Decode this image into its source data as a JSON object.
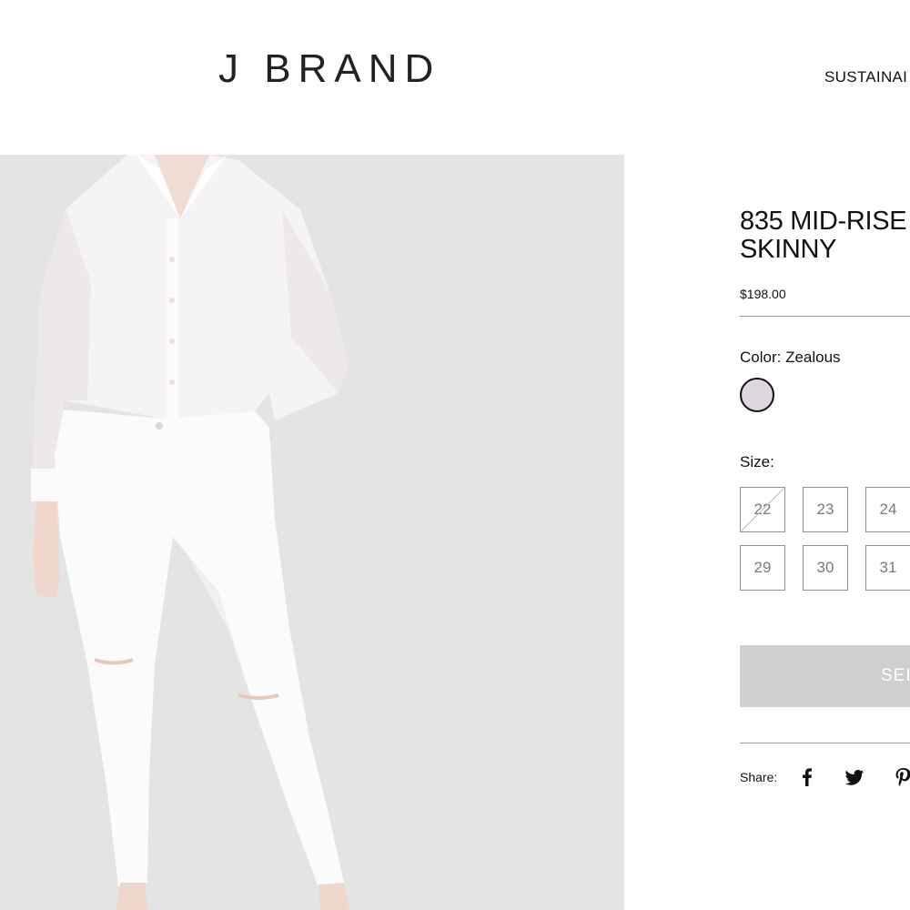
{
  "header": {
    "logo": "J BRAND",
    "nav": [
      "SUSTAINAI"
    ]
  },
  "product": {
    "title": "835 MID-RISE\nSKINNY",
    "price": "$198.00",
    "color_label": "Color: Zealous",
    "color_swatch": "#dcd8de",
    "size_label": "Size:",
    "sizes": [
      {
        "label": "22",
        "available": false
      },
      {
        "label": "23",
        "available": true
      },
      {
        "label": "24",
        "available": true
      },
      {
        "label": "29",
        "available": true
      },
      {
        "label": "30",
        "available": true
      },
      {
        "label": "31",
        "available": true
      }
    ],
    "cta_label": "SEI",
    "share_label": "Share:",
    "share_icons": [
      "facebook-icon",
      "twitter-icon",
      "pinterest-icon"
    ]
  },
  "colors": {
    "image_background": "#e4e4e4",
    "cta_background": "#cfcfcf",
    "divider": "#9a9a9a"
  }
}
